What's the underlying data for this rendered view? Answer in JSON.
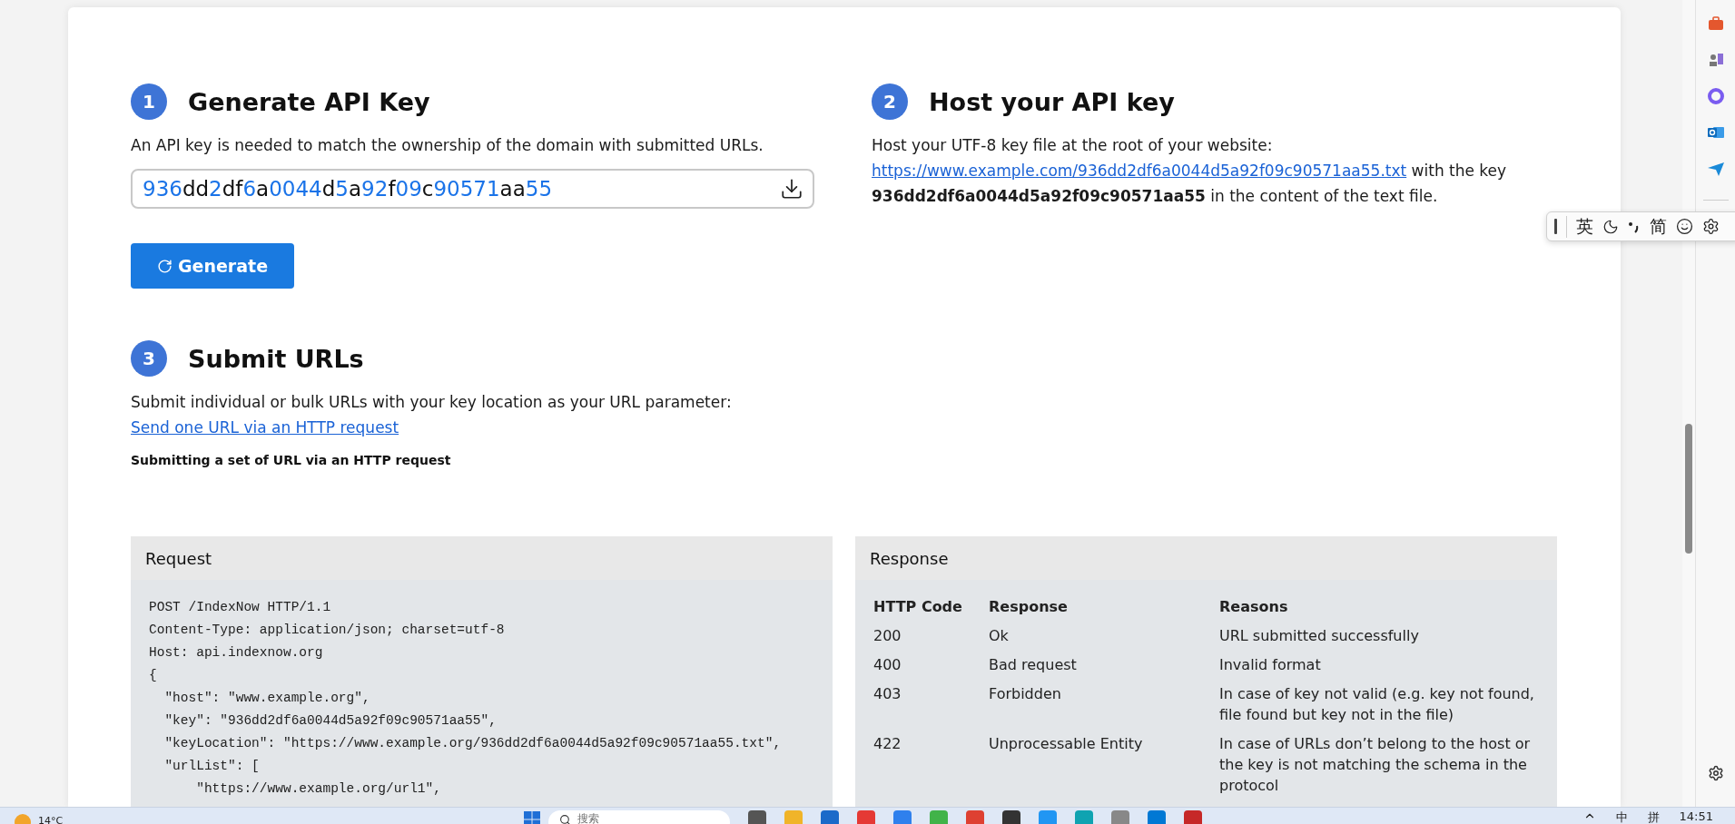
{
  "generate": {
    "number": "1",
    "title": "Generate API Key",
    "description": "An API key is needed to match the ownership of the domain with submitted URLs.",
    "key_segments": [
      {
        "text": "936",
        "kind": "digit"
      },
      {
        "text": "dd",
        "kind": "letter"
      },
      {
        "text": "2",
        "kind": "digit"
      },
      {
        "text": "df",
        "kind": "letter"
      },
      {
        "text": "6",
        "kind": "digit"
      },
      {
        "text": "a",
        "kind": "letter"
      },
      {
        "text": "0044",
        "kind": "digit"
      },
      {
        "text": "d",
        "kind": "letter"
      },
      {
        "text": "5",
        "kind": "digit"
      },
      {
        "text": "a",
        "kind": "letter"
      },
      {
        "text": "92",
        "kind": "digit"
      },
      {
        "text": "f",
        "kind": "letter"
      },
      {
        "text": "09",
        "kind": "digit"
      },
      {
        "text": "c",
        "kind": "letter"
      },
      {
        "text": "90571",
        "kind": "digit"
      },
      {
        "text": "aa",
        "kind": "letter"
      },
      {
        "text": "55",
        "kind": "digit"
      }
    ],
    "button": "Generate"
  },
  "host": {
    "number": "2",
    "title": "Host your API key",
    "intro": "Host your UTF-8 key file at the root of your website:",
    "link": "https://www.example.com/936dd2df6a0044d5a92f09c90571aa55.txt",
    "rest": "with the key **936dd2df6a0044d5a92f09c90571aa55** in the content of the text file."
  },
  "submit": {
    "number": "3",
    "title": "Submit URLs",
    "description": "Submit individual or bulk URLs with your key location as your URL parameter:",
    "link": "Send one URL via an HTTP request",
    "subheading": "Submitting a set of URL via an HTTP request"
  },
  "request_panel": {
    "title": "Request",
    "code_lines": [
      "POST /IndexNow HTTP/1.1",
      "Content-Type: application/json; charset=utf-8",
      "Host: api.indexnow.org",
      "{",
      "  \"host\": \"www.example.org\",",
      "  \"key\": \"936dd2df6a0044d5a92f09c90571aa55\",",
      "  \"keyLocation\": \"https://www.example.org/936dd2df6a0044d5a92f09c90571aa55.txt\",",
      "  \"urlList\": [",
      "      \"https://www.example.org/url1\","
    ]
  },
  "response_panel": {
    "title": "Response",
    "columns": [
      "HTTP Code",
      "Response",
      "Reasons"
    ],
    "rows": [
      [
        "200",
        "Ok",
        "URL submitted successfully"
      ],
      [
        "400",
        "Bad request",
        "Invalid format"
      ],
      [
        "403",
        "Forbidden",
        "In case of key not valid (e.g. key not found, file found but key not in the file)"
      ],
      [
        "422",
        "Unprocessable Entity",
        "In case of URLs don’t belong to the host or the key is not matching the schema in the protocol"
      ]
    ]
  },
  "ime_toolbar": {
    "labels": [
      "英",
      "简"
    ]
  },
  "taskbar": {
    "weather": "14°C",
    "search_placeholder": "搜索",
    "tray": [
      "中",
      "拼"
    ],
    "time": "14:51"
  }
}
